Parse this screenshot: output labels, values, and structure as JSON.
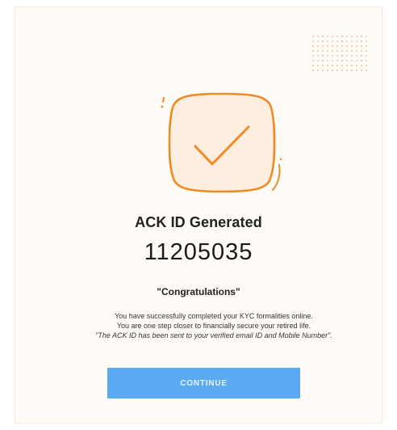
{
  "dialog": {
    "title": "ACK ID Generated",
    "ack_id": "11205035",
    "congratulations": "\"Congratulations\"",
    "message_line_1": "You have successfully completed your KYC formalities online.",
    "message_line_2": "You are one step closer to financially secure your retired life.",
    "message_note": "\"The ACK ID has been sent to your verified email ID and Mobile Number\".",
    "continue_label": "CONTINUE"
  },
  "icons": {
    "success": "checkmark-icon",
    "decoration": "dot-pattern"
  },
  "colors": {
    "accent_orange": "#f08a24",
    "icon_fill": "#fdeee0",
    "button_blue": "#5aaaf3",
    "dot_color": "#f6c7a8",
    "card_background": "#fffcf7"
  }
}
